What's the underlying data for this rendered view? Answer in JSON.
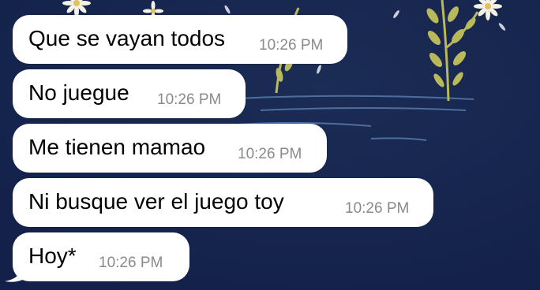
{
  "chat": {
    "messages": [
      {
        "text": "Que se vayan todos",
        "time": "10:26 PM"
      },
      {
        "text": "No juegue",
        "time": "10:26 PM"
      },
      {
        "text": "Me tienen mamao",
        "time": "10:26 PM"
      },
      {
        "text": "Ni busque ver el juego toy",
        "time": "10:26 PM"
      },
      {
        "text": "Hoy*",
        "time": "10:26 PM"
      }
    ]
  },
  "colors": {
    "wallpaper": "#16254a",
    "bubble": "#ffffff",
    "timestamp": "#8a8a8e",
    "stem": "#b9b85a"
  },
  "wallpaper_icons": [
    "daisy-flower-icon",
    "leaf-stem-icon",
    "water-ripple-icon"
  ]
}
